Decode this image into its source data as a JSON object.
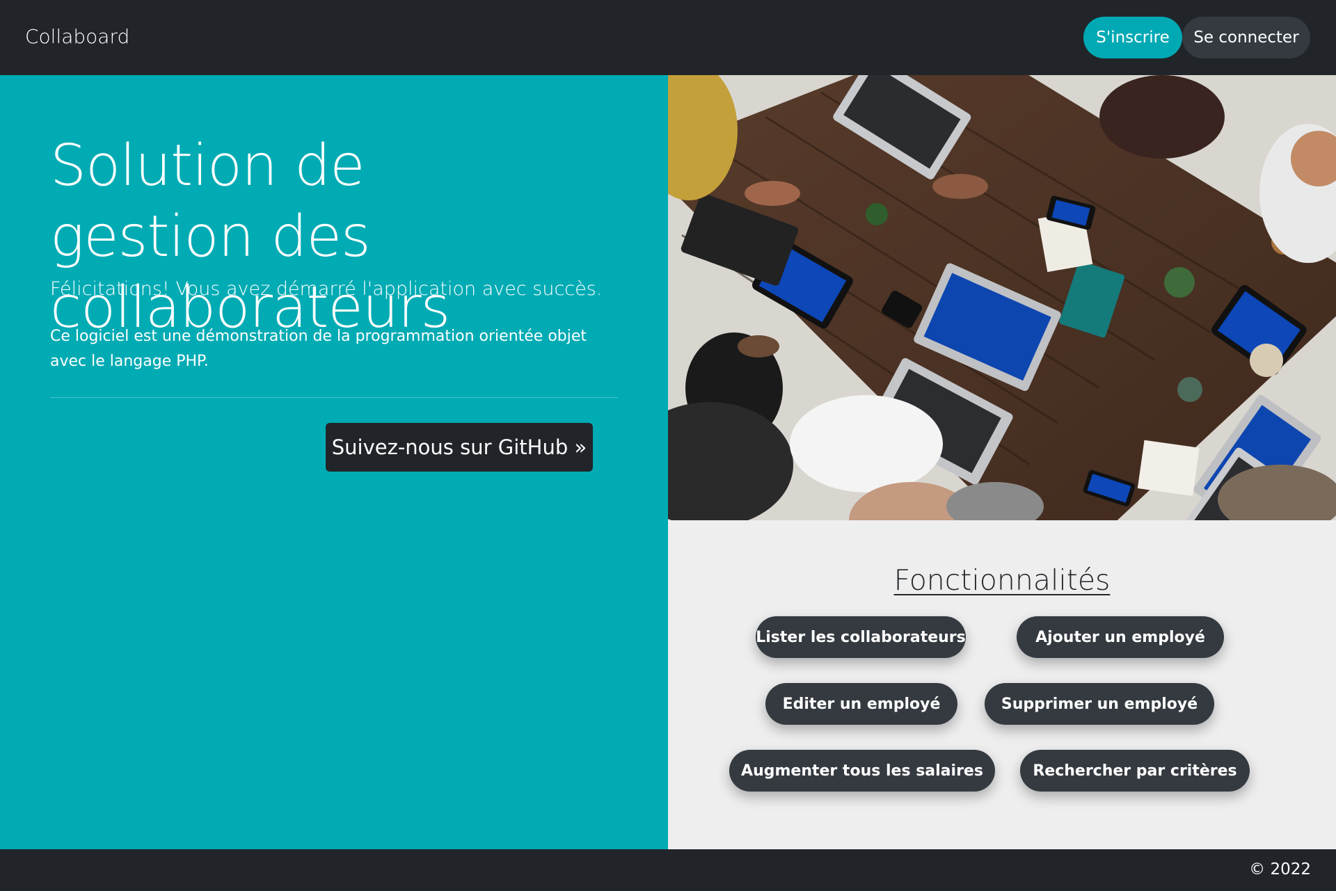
{
  "navbar": {
    "brand": "Collaboard",
    "signup_label": "S'inscrire",
    "login_label": "Se connecter"
  },
  "hero": {
    "title": "Solution de gestion des collaborateurs",
    "lead": "Félicitations! Vous avez démarré l'application avec succès.",
    "text": "Ce logiciel est une démonstration de la programmation orientée objet avec le langage PHP.",
    "github_label": "Suivez-nous sur GitHub »"
  },
  "features": {
    "title": "Fonctionnalités",
    "buttons": [
      {
        "label": "Lister les collaborateurs"
      },
      {
        "label": "Ajouter un employé"
      },
      {
        "label": "Editer un employé"
      },
      {
        "label": "Supprimer un employé"
      },
      {
        "label": "Augmenter tous les salaires"
      },
      {
        "label": "Rechercher par critères"
      }
    ]
  },
  "footer": {
    "copyright": "© 2022"
  },
  "colors": {
    "navbar": "#212529",
    "accent_teal": "#00abb4",
    "signup_button": "#00a9b4",
    "dark_button": "#343a40",
    "features_bg": "#eeeeee"
  }
}
